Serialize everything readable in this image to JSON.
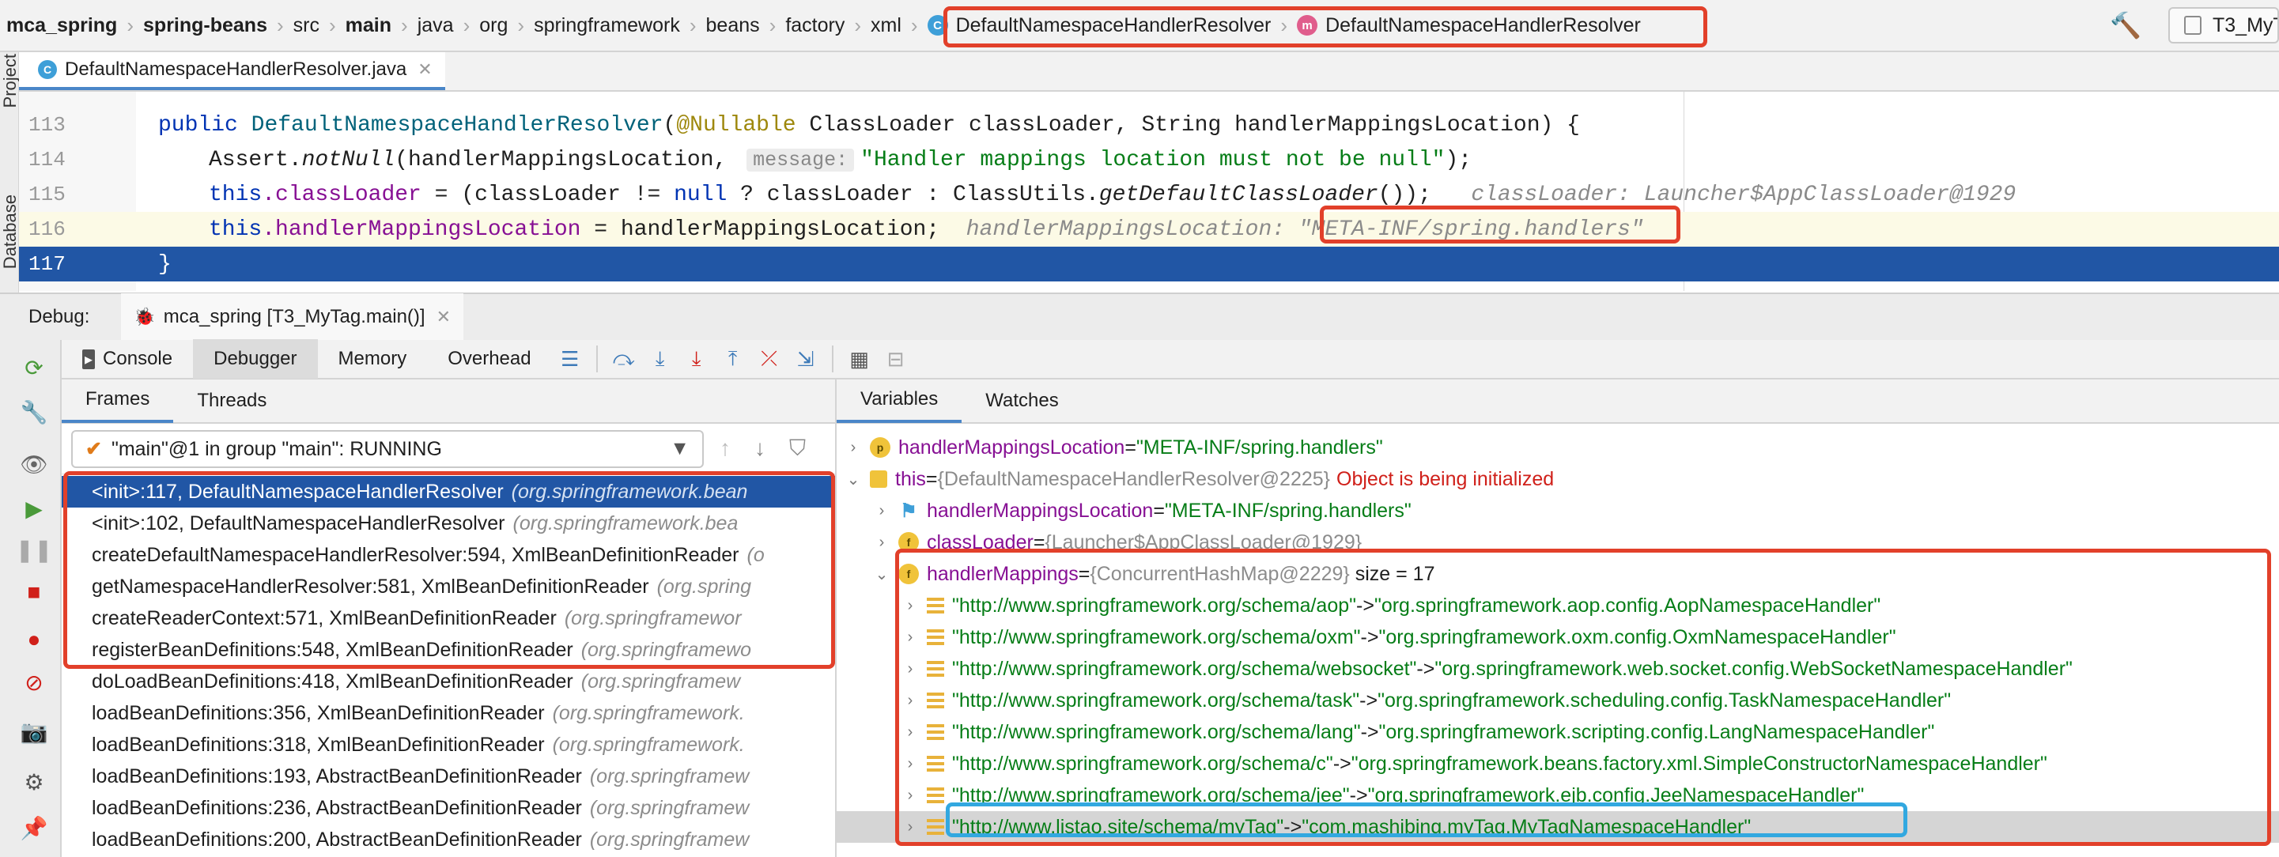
{
  "breadcrumb": {
    "items": [
      "mca_spring",
      "spring-beans",
      "src",
      "main",
      "java",
      "org",
      "springframework",
      "beans",
      "factory",
      "xml"
    ],
    "class_name": "DefaultNamespaceHandlerResolver",
    "method_name": "DefaultNamespaceHandlerResolver",
    "class_icon_letter": "C",
    "method_icon_letter": "m"
  },
  "run_config": {
    "label": "T3_MyT"
  },
  "left_strip": {
    "project": "Project",
    "database": "Database"
  },
  "editor_tab": {
    "filename": "DefaultNamespaceHandlerResolver.java",
    "icon_letter": "C"
  },
  "code": {
    "lines": [
      {
        "num": "113"
      },
      {
        "num": "114"
      },
      {
        "num": "115"
      },
      {
        "num": "116"
      },
      {
        "num": "117"
      }
    ],
    "l113": {
      "kw1": "public",
      "name": "DefaultNamespaceHandlerResolver",
      "paren": "(",
      "ann": "@Nullable",
      "rest": " ClassLoader classLoader, String handlerMappingsLocation) {"
    },
    "l114": {
      "pre": "Assert.",
      "method": "notNull",
      "args": "(handlerMappingsLocation, ",
      "hint": "message:",
      "str": "\"Handler mappings location must not be null\"",
      "end": ");"
    },
    "l115": {
      "this": "this",
      "field": ".classLoader",
      "mid": " = (classLoader != ",
      "null": "null",
      "mid2": " ? classLoader : ClassUtils.",
      "method": "getDefaultClassLoader",
      "end": "());",
      "inline": "classLoader: Launcher$AppClassLoader@1929"
    },
    "l116": {
      "this": "this",
      "field": ".handlerMappingsLocation",
      "rest": " = handlerMappingsLocation;",
      "inline_label": "handlerMappingsLocation:",
      "inline_value": "\"META-INF/spring.handlers\""
    },
    "l117": {
      "brace": "}"
    }
  },
  "debug": {
    "label": "Debug:",
    "session": "mca_spring [T3_MyTag.main()]",
    "tabs": [
      "Console",
      "Debugger",
      "Memory",
      "Overhead"
    ],
    "frames_tab": "Frames",
    "threads_tab": "Threads",
    "variables_tab": "Variables",
    "watches_tab": "Watches",
    "thread": "\"main\"@1 in group \"main\": RUNNING"
  },
  "frames": [
    {
      "method": "<init>:117, DefaultNamespaceHandlerResolver",
      "pkg": "(org.springframework.bean"
    },
    {
      "method": "<init>:102, DefaultNamespaceHandlerResolver",
      "pkg": "(org.springframework.bea"
    },
    {
      "method": "createDefaultNamespaceHandlerResolver:594, XmlBeanDefinitionReader",
      "pkg": "(o"
    },
    {
      "method": "getNamespaceHandlerResolver:581, XmlBeanDefinitionReader",
      "pkg": "(org.spring"
    },
    {
      "method": "createReaderContext:571, XmlBeanDefinitionReader",
      "pkg": "(org.springframewor"
    },
    {
      "method": "registerBeanDefinitions:548, XmlBeanDefinitionReader",
      "pkg": "(org.springframewo"
    },
    {
      "method": "doLoadBeanDefinitions:418, XmlBeanDefinitionReader",
      "pkg": "(org.springframew"
    },
    {
      "method": "loadBeanDefinitions:356, XmlBeanDefinitionReader",
      "pkg": "(org.springframework."
    },
    {
      "method": "loadBeanDefinitions:318, XmlBeanDefinitionReader",
      "pkg": "(org.springframework."
    },
    {
      "method": "loadBeanDefinitions:193, AbstractBeanDefinitionReader",
      "pkg": "(org.springframew"
    },
    {
      "method": "loadBeanDefinitions:236, AbstractBeanDefinitionReader",
      "pkg": "(org.springframew"
    },
    {
      "method": "loadBeanDefinitions:200, AbstractBeanDefinitionReader",
      "pkg": "(org.springframew"
    }
  ],
  "variables": {
    "v1": {
      "name": "handlerMappingsLocation",
      "eq": " = ",
      "value": "\"META-INF/spring.handlers\""
    },
    "v2": {
      "name": "this",
      "eq": " = ",
      "ref": "{DefaultNamespaceHandlerResolver@2225}",
      "warn": "Object is being initialized"
    },
    "v3": {
      "name": "handlerMappingsLocation",
      "eq": " = ",
      "value": "\"META-INF/spring.handlers\""
    },
    "v4": {
      "name": "classLoader",
      "eq": " = ",
      "ref": "{Launcher$AppClassLoader@1929}"
    },
    "v5": {
      "name": "handlerMappings",
      "eq": " = ",
      "ref": "{ConcurrentHashMap@2229}",
      "size": "size = 17"
    },
    "map_entries": [
      {
        "key": "\"http://www.springframework.org/schema/aop\"",
        "value": "\"org.springframework.aop.config.AopNamespaceHandler\""
      },
      {
        "key": "\"http://www.springframework.org/schema/oxm\"",
        "value": "\"org.springframework.oxm.config.OxmNamespaceHandler\""
      },
      {
        "key": "\"http://www.springframework.org/schema/websocket\"",
        "value": "\"org.springframework.web.socket.config.WebSocketNamespaceHandler\""
      },
      {
        "key": "\"http://www.springframework.org/schema/task\"",
        "value": "\"org.springframework.scheduling.config.TaskNamespaceHandler\""
      },
      {
        "key": "\"http://www.springframework.org/schema/lang\"",
        "value": "\"org.springframework.scripting.config.LangNamespaceHandler\""
      },
      {
        "key": "\"http://www.springframework.org/schema/c\"",
        "value": "\"org.springframework.beans.factory.xml.SimpleConstructorNamespaceHandler\""
      },
      {
        "key": "\"http://www.springframework.org/schema/jee\"",
        "value": "\"org.springframework.ejb.config.JeeNamespaceHandler\""
      },
      {
        "key": "\"http://www.listao.site/schema/myTag\"",
        "value": "\"com.mashibing.myTag.MyTagNamespaceHandler\""
      }
    ],
    "arrow_sep": " -> "
  },
  "colors": {
    "highlight_red": "#e2402a",
    "highlight_blue": "#32a8e0",
    "exec_line": "#2156a5"
  }
}
